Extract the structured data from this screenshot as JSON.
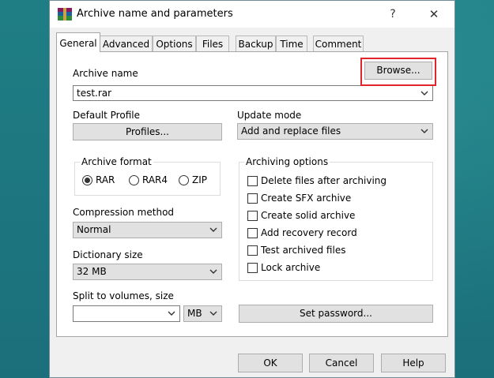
{
  "window": {
    "title": "Archive name and parameters",
    "help_glyph": "?",
    "close_glyph": "✕"
  },
  "tabs": [
    {
      "label": "General",
      "active": true
    },
    {
      "label": "Advanced"
    },
    {
      "label": "Options"
    },
    {
      "label": "Files"
    },
    {
      "label": "Backup"
    },
    {
      "label": "Time"
    },
    {
      "label": "Comment"
    }
  ],
  "general": {
    "archive_name_label": "Archive name",
    "browse_label": "Browse...",
    "archive_name_value": "test.rar",
    "default_profile_label": "Default Profile",
    "profiles_label": "Profiles...",
    "update_mode_label": "Update mode",
    "update_mode_value": "Add and replace files",
    "archive_format": {
      "title": "Archive format",
      "options": [
        "RAR",
        "RAR4",
        "ZIP"
      ],
      "selected": "RAR"
    },
    "compression_method_label": "Compression method",
    "compression_method_value": "Normal",
    "dictionary_size_label": "Dictionary size",
    "dictionary_size_value": "32 MB",
    "split_label": "Split to volumes, size",
    "split_value": "",
    "split_unit": "MB",
    "archiving_options": {
      "title": "Archiving options",
      "items": [
        {
          "label": "Delete files after archiving",
          "checked": false
        },
        {
          "label": "Create SFX archive",
          "checked": false
        },
        {
          "label": "Create solid archive",
          "checked": false
        },
        {
          "label": "Add recovery record",
          "checked": false
        },
        {
          "label": "Test archived files",
          "checked": false
        },
        {
          "label": "Lock archive",
          "checked": false
        }
      ]
    },
    "set_password_label": "Set password..."
  },
  "footer": {
    "ok_label": "OK",
    "cancel_label": "Cancel",
    "help_label": "Help"
  },
  "colors": {
    "desktop": "#1f7e84",
    "highlight": "#e0262a"
  }
}
